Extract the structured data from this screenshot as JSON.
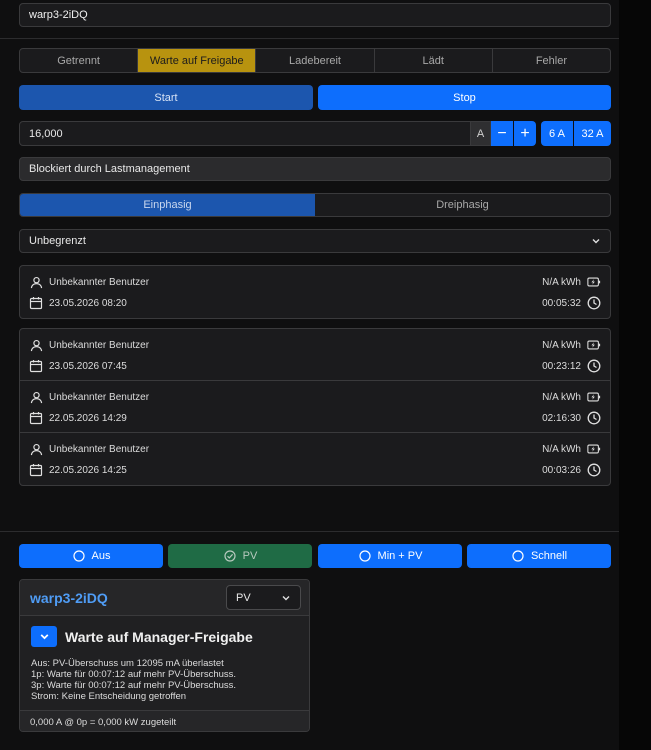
{
  "charger_name": "warp3-2iDQ",
  "state_bar": [
    {
      "label": "Getrennt",
      "active": false
    },
    {
      "label": "Warte auf Freigabe",
      "active": true
    },
    {
      "label": "Ladebereit",
      "active": false
    },
    {
      "label": "Lädt",
      "active": false
    },
    {
      "label": "Fehler",
      "active": false
    }
  ],
  "buttons": {
    "start": "Start",
    "stop": "Stop"
  },
  "current": {
    "value": "16,000",
    "unit": "A",
    "minus": "−",
    "plus": "+",
    "min_preset": "6 A",
    "max_preset": "32 A"
  },
  "blocked_text": "Blockiert durch Lastmanagement",
  "phases": [
    {
      "label": "Einphasig",
      "active": true
    },
    {
      "label": "Dreiphasig",
      "active": false
    }
  ],
  "limit_select": {
    "value": "Unbegrenzt"
  },
  "current_session": {
    "user": "Unbekannter Benutzer",
    "energy": "N/A kWh",
    "date": "23.05.2026 08:20",
    "duration": "00:05:32"
  },
  "history": [
    {
      "user": "Unbekannter Benutzer",
      "energy": "N/A kWh",
      "date": "23.05.2026 07:45",
      "duration": "00:23:12"
    },
    {
      "user": "Unbekannter Benutzer",
      "energy": "N/A kWh",
      "date": "22.05.2026 14:29",
      "duration": "02:16:30"
    },
    {
      "user": "Unbekannter Benutzer",
      "energy": "N/A kWh",
      "date": "22.05.2026 14:25",
      "duration": "00:03:26"
    }
  ],
  "charge_modes": [
    {
      "label": "Aus",
      "active": false
    },
    {
      "label": "PV",
      "active": true
    },
    {
      "label": "Min + PV",
      "active": false
    },
    {
      "label": "Schnell",
      "active": false
    }
  ],
  "manager_card": {
    "name": "warp3-2iDQ",
    "mode_select": "PV",
    "status_title": "Warte auf Manager-Freigabe",
    "lines": [
      "Aus: PV-Überschuss um 12095 mA überlastet",
      "1p: Warte für 00:07:12 auf mehr PV-Überschuss.",
      "3p: Warte für 00:07:12 auf mehr PV-Überschuss.",
      "Strom: Keine Entscheidung getroffen"
    ],
    "footer": "0,000 A @ 0p = 0,000 kW zugeteilt"
  },
  "colors": {
    "accent": "#0d6efd",
    "waiting": "#b8930f",
    "pv_active": "#1f6b45",
    "link": "#4f9cf5"
  }
}
